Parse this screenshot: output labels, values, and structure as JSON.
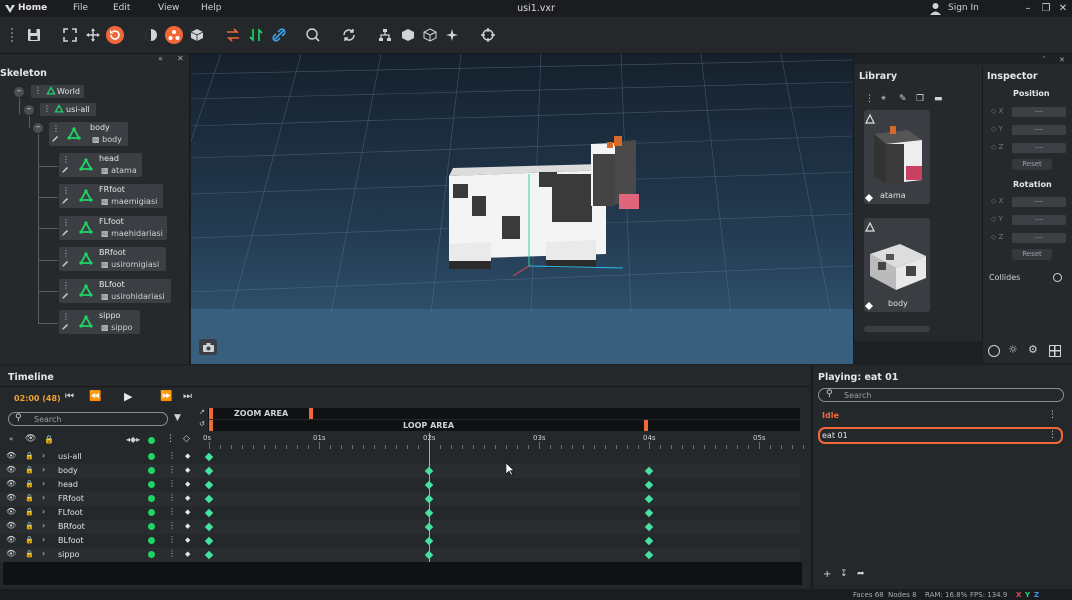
{
  "app": {
    "home_label": "Home",
    "menu": [
      "File",
      "Edit",
      "View",
      "Help"
    ],
    "file_title": "usi1.vxr",
    "sign_in": "Sign In",
    "win_controls": [
      "minimize-icon",
      "restore-icon",
      "close-icon"
    ]
  },
  "skeleton": {
    "title": "Skeleton",
    "nodes": [
      {
        "name": "World"
      },
      {
        "name": "usi-all"
      },
      {
        "name": "body",
        "mesh": "body"
      },
      {
        "name": "head",
        "mesh": "atama"
      },
      {
        "name": "FRfoot",
        "mesh": "maemigiasi"
      },
      {
        "name": "FLfoot",
        "mesh": "maehidariasi"
      },
      {
        "name": "BRfoot",
        "mesh": "usiromigiasi"
      },
      {
        "name": "BLfoot",
        "mesh": "usirohidariasi"
      },
      {
        "name": "sippo",
        "mesh": "sippo"
      }
    ]
  },
  "library": {
    "title": "Library",
    "items": [
      {
        "label": "atama"
      },
      {
        "label": "body"
      }
    ]
  },
  "inspector": {
    "title": "Inspector",
    "position_label": "Position",
    "rotation_label": "Rotation",
    "axes": [
      "X",
      "Y",
      "Z"
    ],
    "field_value": "----",
    "reset_label": "Reset",
    "collides_label": "Collides"
  },
  "timeline": {
    "title": "Timeline",
    "time_readout": "02:00 (48)",
    "search_placeholder": "Search",
    "zoom_area": "ZOOM AREA",
    "loop_area": "LOOP AREA",
    "ticks": [
      "0s",
      "01s",
      "02s",
      "03s",
      "04s",
      "05s"
    ],
    "tracks": [
      {
        "name": "usi-all",
        "keys": [
          0
        ]
      },
      {
        "name": "body",
        "keys": [
          0,
          2,
          4
        ]
      },
      {
        "name": "head",
        "keys": [
          0,
          2,
          4
        ]
      },
      {
        "name": "FRfoot",
        "keys": [
          0,
          2,
          4
        ]
      },
      {
        "name": "FLfoot",
        "keys": [
          0,
          2,
          4
        ]
      },
      {
        "name": "BRfoot",
        "keys": [
          0,
          2,
          4
        ]
      },
      {
        "name": "BLfoot",
        "keys": [
          0,
          2,
          4
        ]
      },
      {
        "name": "sippo",
        "keys": [
          0,
          2,
          4
        ]
      }
    ],
    "playhead_seconds": 2
  },
  "playing": {
    "title": "Playing: eat 01",
    "search_placeholder": "Search",
    "animations": [
      {
        "name": "Idle",
        "selected": false
      },
      {
        "name": "eat 01",
        "selected": true
      }
    ]
  },
  "status": {
    "faces": "Faces 68",
    "nodes": "Nodes 8",
    "ram": "RAM: 16.8%",
    "fps": "FPS: 134.9",
    "axes": [
      "X",
      "Y",
      "Z"
    ]
  },
  "colors": {
    "accent_orange": "#f0683a",
    "bone_green": "#1fd665",
    "keyframe": "#46e2a0",
    "playhead": "#e8a13a"
  }
}
